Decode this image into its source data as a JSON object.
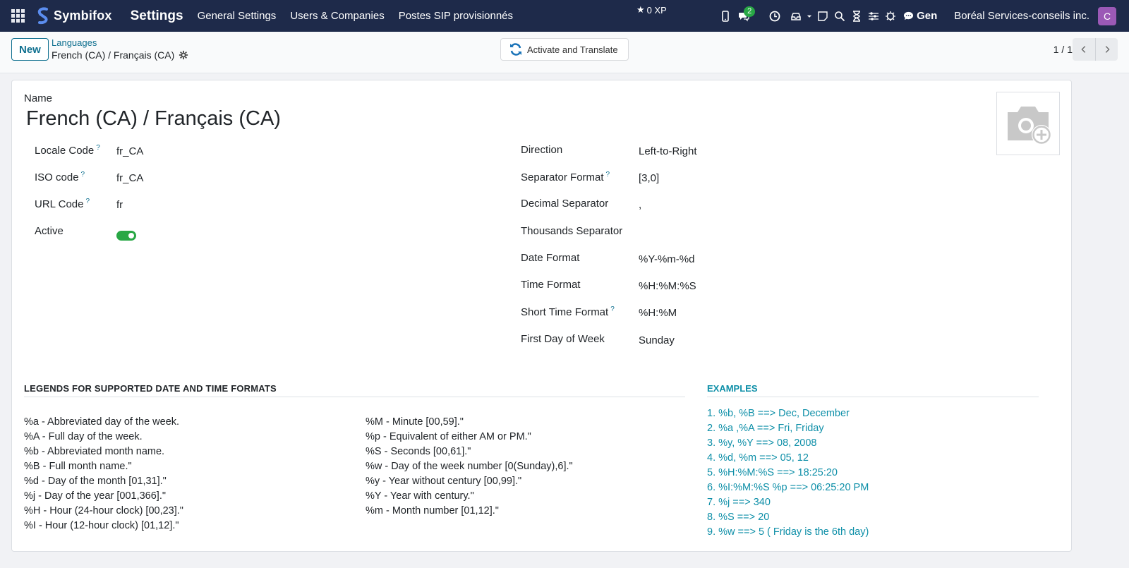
{
  "navbar": {
    "brand": "Symbifox",
    "app_title": "Settings",
    "menu": [
      "General Settings",
      "Users & Companies",
      "Postes SIP provisionnés"
    ],
    "xp": "0 XP",
    "chat_badge": "2",
    "gen_label": "Gen",
    "company": "Boréal Services-conseils inc.",
    "avatar_letter": "C"
  },
  "control": {
    "new_label": "New",
    "breadcrumb_parent": "Languages",
    "breadcrumb_current": "French (CA) / Français (CA)",
    "activate_label": "Activate and Translate",
    "pager": "1 / 1"
  },
  "form": {
    "name_label": "Name",
    "name_value": "French (CA) / Français (CA)",
    "left_fields": [
      {
        "label": "Locale Code",
        "help": "?",
        "value": "fr_CA"
      },
      {
        "label": "ISO code",
        "help": "?",
        "value": "fr_CA"
      },
      {
        "label": "URL Code",
        "help": "?",
        "value": "fr"
      },
      {
        "label": "Active",
        "help": "",
        "value": ""
      }
    ],
    "right_fields": [
      {
        "label": "Direction",
        "help": "",
        "value": "Left-to-Right"
      },
      {
        "label": "Separator Format",
        "help": "?",
        "value": "[3,0]"
      },
      {
        "label": "Decimal Separator",
        "help": "",
        "value": ","
      },
      {
        "label": "Thousands Separator",
        "help": "",
        "value": ""
      },
      {
        "label": "Date Format",
        "help": "",
        "value": "%Y-%m-%d"
      },
      {
        "label": "Time Format",
        "help": "",
        "value": "%H:%M:%S"
      },
      {
        "label": "Short Time Format",
        "help": "?",
        "value": "%H:%M"
      },
      {
        "label": "First Day of Week",
        "help": "",
        "value": "Sunday"
      }
    ],
    "active": true
  },
  "legends": {
    "title": "LEGENDS FOR SUPPORTED DATE AND TIME FORMATS",
    "col1": [
      "%a - Abbreviated day of the week.",
      "%A - Full day of the week.",
      "%b - Abbreviated month name.",
      "%B - Full month name.\"",
      "%d - Day of the month [01,31].\"",
      "%j - Day of the year [001,366].\"",
      "%H - Hour (24-hour clock) [00,23].\"",
      "%I - Hour (12-hour clock) [01,12].\""
    ],
    "col2": [
      "%M - Minute [00,59].\"",
      "%p - Equivalent of either AM or PM.\"",
      "%S - Seconds [00,61].\"",
      "%w - Day of the week number [0(Sunday),6].\"",
      "%y - Year without century [00,99].\"",
      "%Y - Year with century.\"",
      "%m - Month number [01,12].\""
    ]
  },
  "examples": {
    "title": "EXAMPLES",
    "items": [
      "1. %b, %B ==> Dec, December",
      "2. %a ,%A ==> Fri, Friday",
      "3. %y, %Y ==> 08, 2008",
      "4. %d, %m ==> 05, 12",
      "5. %H:%M:%S ==> 18:25:20",
      "6. %I:%M:%S %p ==> 06:25:20 PM",
      "7. %j ==> 340",
      "8. %S ==> 20",
      "9. %w ==> 5 ( Friday is the 6th day)"
    ]
  }
}
